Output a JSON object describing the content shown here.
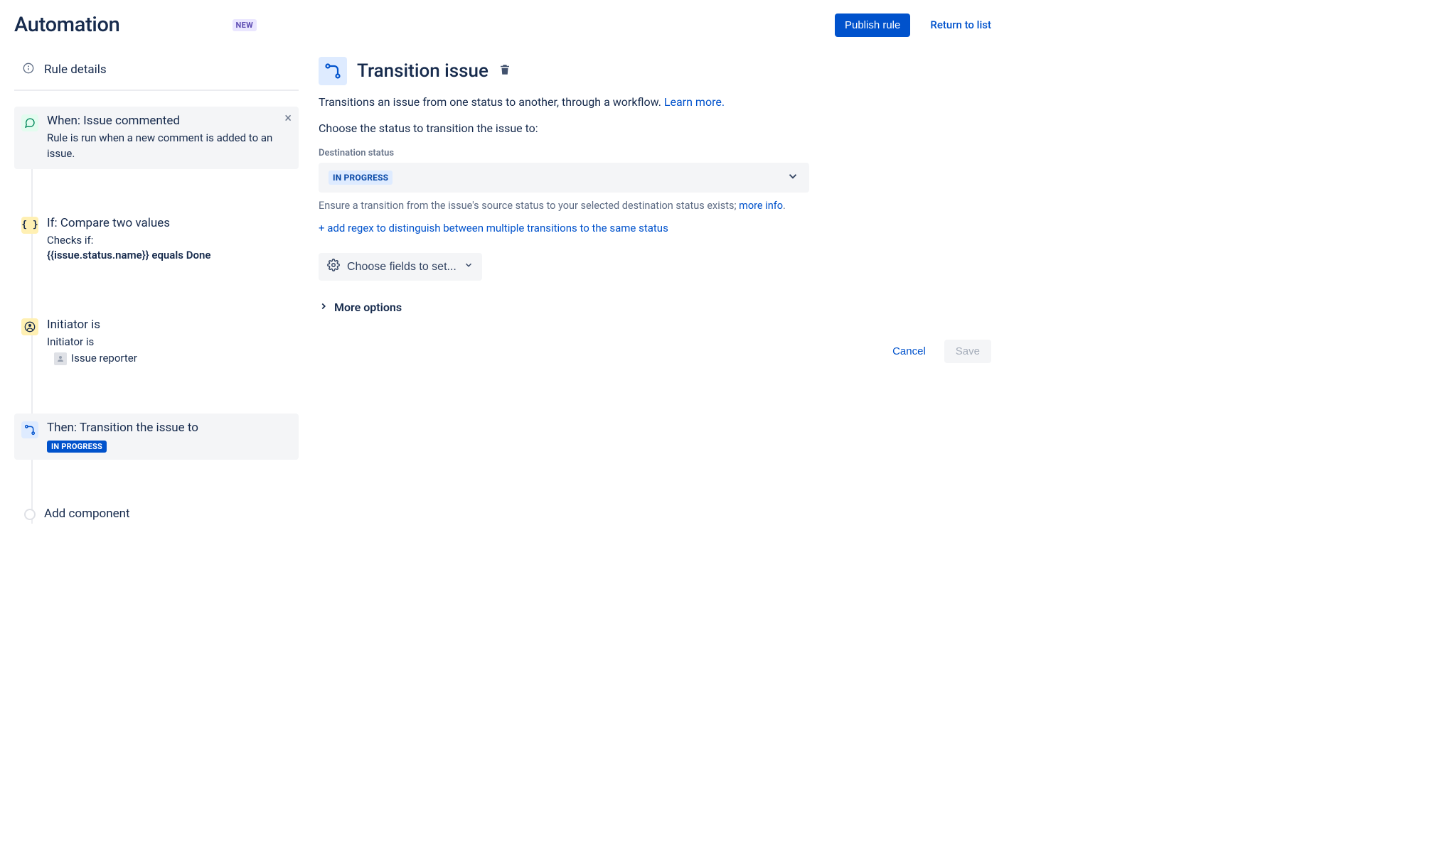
{
  "header": {
    "title": "Automation",
    "new_badge": "NEW",
    "publish_label": "Publish rule",
    "return_label": "Return to list"
  },
  "sidebar": {
    "rule_details_label": "Rule details",
    "steps": {
      "trigger": {
        "title": "When: Issue commented",
        "desc": "Rule is run when a new comment is added to an issue."
      },
      "condition_compare": {
        "title": "If: Compare two values",
        "desc_prefix": "Checks if:",
        "desc_bold": "{{issue.status.name}} equals Done"
      },
      "condition_initiator": {
        "title": "Initiator is",
        "desc_prefix": "Initiator is",
        "reporter_label": "Issue reporter"
      },
      "action_transition": {
        "title": "Then: Transition the issue to",
        "status_lozenge": "IN PROGRESS"
      },
      "add_component": {
        "title": "Add component"
      }
    }
  },
  "panel": {
    "title": "Transition issue",
    "subtitle_text": "Transitions an issue from one status to another, through a workflow. ",
    "learn_more": "Learn more.",
    "choose_prompt": "Choose the status to transition the issue to:",
    "dest_label": "Destination status",
    "dest_value": "IN PROGRESS",
    "help_pre": "Ensure a transition from the issue's source status to your selected destination status exists; ",
    "help_link": "more info",
    "help_post": ".",
    "regex_link": "+ add regex to distinguish between multiple transitions to the same status",
    "fields_btn": "Choose fields to set...",
    "more_options": "More options",
    "cancel": "Cancel",
    "save": "Save"
  }
}
